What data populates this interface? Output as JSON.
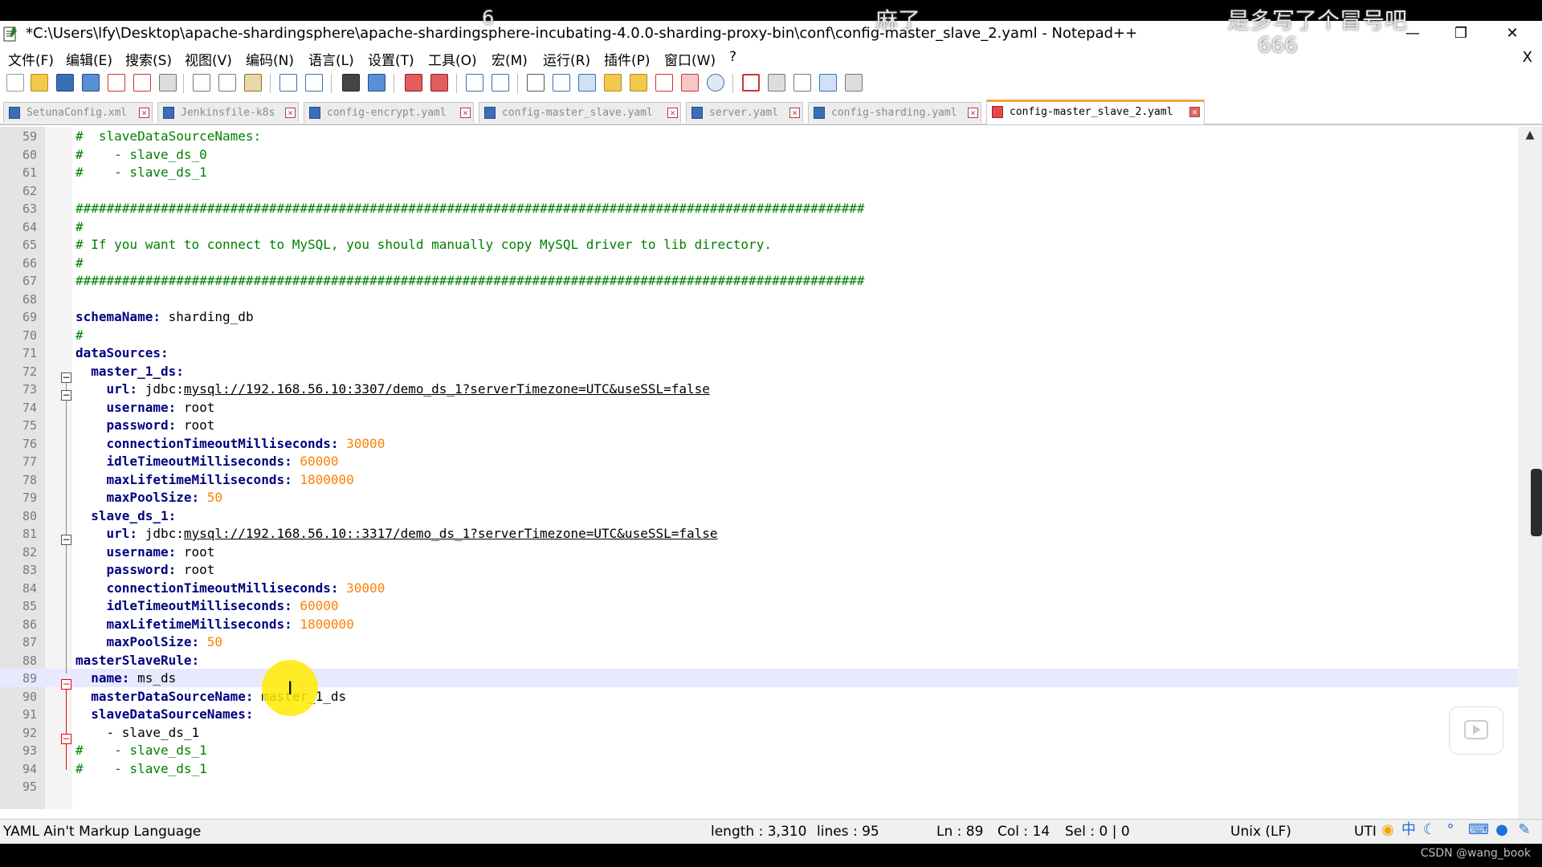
{
  "titlebar": {
    "title": "*C:\\Users\\lfy\\Desktop\\apache-shardingsphere\\apache-shardingsphere-incubating-4.0.0-sharding-proxy-bin\\conf\\config-master_slave_2.yaml - Notepad++",
    "icon": "notepad-icon"
  },
  "overlays": {
    "top_number": "6",
    "top_text": "麻了",
    "right_text": "是多写了个冒号吧",
    "right_number": "666"
  },
  "menu": [
    "文件(F)",
    "编辑(E)",
    "搜索(S)",
    "视图(V)",
    "编码(N)",
    "语言(L)",
    "设置(T)",
    "工具(O)",
    "宏(M)",
    "运行(R)",
    "插件(P)",
    "窗口(W)",
    "?"
  ],
  "menu_close": "X",
  "tabs": [
    {
      "label": "SetunaConfig.xml",
      "active": false
    },
    {
      "label": "Jenkinsfile-k8s",
      "active": false
    },
    {
      "label": "config-encrypt.yaml",
      "active": false
    },
    {
      "label": "config-master_slave.yaml",
      "active": false
    },
    {
      "label": "server.yaml",
      "active": false
    },
    {
      "label": "config-sharding.yaml",
      "active": false
    },
    {
      "label": "config-master_slave_2.yaml",
      "active": true
    }
  ],
  "editor": {
    "current_line": 89,
    "lines": [
      {
        "n": "59",
        "html": "<span class=\"c\">#  slaveDataSourceNames:</span>"
      },
      {
        "n": "60",
        "html": "<span class=\"c\">#    - slave_ds_0</span>"
      },
      {
        "n": "61",
        "html": "<span class=\"c\">#    - slave_ds_1</span>"
      },
      {
        "n": "62",
        "html": ""
      },
      {
        "n": "63",
        "html": "<span class=\"c\">######################################################################################################</span>"
      },
      {
        "n": "64",
        "html": "<span class=\"c\">#</span>"
      },
      {
        "n": "65",
        "html": "<span class=\"c\"># If you want to connect to MySQL, you should manually copy MySQL driver to lib directory.</span>"
      },
      {
        "n": "66",
        "html": "<span class=\"c\">#</span>"
      },
      {
        "n": "67",
        "html": "<span class=\"c\">######################################################################################################</span>"
      },
      {
        "n": "68",
        "html": ""
      },
      {
        "n": "69",
        "html": "<span class=\"k2\">schemaName:</span> <span class=\"v\">sharding_db</span>"
      },
      {
        "n": "70",
        "html": "<span class=\"c\">#</span>"
      },
      {
        "n": "71",
        "html": "<span class=\"k2\">dataSources:</span>"
      },
      {
        "n": "72",
        "html": "  <span class=\"k\">master_1_ds:</span>"
      },
      {
        "n": "73",
        "html": "    <span class=\"k\">url:</span> jdbc:<span class=\"u\">mysql://192.168.56.10:3307/demo_ds_1?serverTimezone=UTC&amp;useSSL=false</span>"
      },
      {
        "n": "74",
        "html": "    <span class=\"k\">username:</span> root"
      },
      {
        "n": "75",
        "html": "    <span class=\"k\">password:</span> root"
      },
      {
        "n": "76",
        "html": "    <span class=\"k\">connectionTimeoutMilliseconds:</span> <span class=\"n\">30000</span>"
      },
      {
        "n": "77",
        "html": "    <span class=\"k\">idleTimeoutMilliseconds:</span> <span class=\"n\">60000</span>"
      },
      {
        "n": "78",
        "html": "    <span class=\"k\">maxLifetimeMilliseconds:</span> <span class=\"n\">1800000</span>"
      },
      {
        "n": "79",
        "html": "    <span class=\"k\">maxPoolSize:</span> <span class=\"n\">50</span>"
      },
      {
        "n": "80",
        "html": "  <span class=\"k\">slave_ds_1:</span>"
      },
      {
        "n": "81",
        "html": "    <span class=\"k\">url:</span> jdbc:<span class=\"u\">mysql://192.168.56.10::3317/demo_ds_1?serverTimezone=UTC&amp;useSSL=false</span>"
      },
      {
        "n": "82",
        "html": "    <span class=\"k\">username:</span> root"
      },
      {
        "n": "83",
        "html": "    <span class=\"k\">password:</span> root"
      },
      {
        "n": "84",
        "html": "    <span class=\"k\">connectionTimeoutMilliseconds:</span> <span class=\"n\">30000</span>"
      },
      {
        "n": "85",
        "html": "    <span class=\"k\">idleTimeoutMilliseconds:</span> <span class=\"n\">60000</span>"
      },
      {
        "n": "86",
        "html": "    <span class=\"k\">maxLifetimeMilliseconds:</span> <span class=\"n\">1800000</span>"
      },
      {
        "n": "87",
        "html": "    <span class=\"k\">maxPoolSize:</span> <span class=\"n\">50</span>"
      },
      {
        "n": "88",
        "html": "<span class=\"k2\">masterSlaveRule:</span>"
      },
      {
        "n": "89",
        "html": "  <span class=\"k\">name:</span> ms_ds"
      },
      {
        "n": "90",
        "html": "  <span class=\"k\">masterDataSourceName:</span> master_1_ds"
      },
      {
        "n": "91",
        "html": "  <span class=\"k\">slaveDataSourceNames:</span>"
      },
      {
        "n": "92",
        "html": "    - slave_ds_1"
      },
      {
        "n": "93",
        "html": "<span class=\"c\">#    - slave_ds_1</span>"
      },
      {
        "n": "94",
        "html": "<span class=\"c\">#    - slave_ds_1</span>"
      },
      {
        "n": "95",
        "html": ""
      }
    ]
  },
  "status": {
    "language": "YAML Ain't Markup Language",
    "length": "length : 3,310",
    "lines": "lines : 95",
    "ln": "Ln : 89",
    "col": "Col : 14",
    "sel": "Sel : 0 | 0",
    "eol": "Unix (LF)",
    "encoding": "UTI",
    "ime": "中"
  },
  "watermark": "CSDN @wang_book"
}
